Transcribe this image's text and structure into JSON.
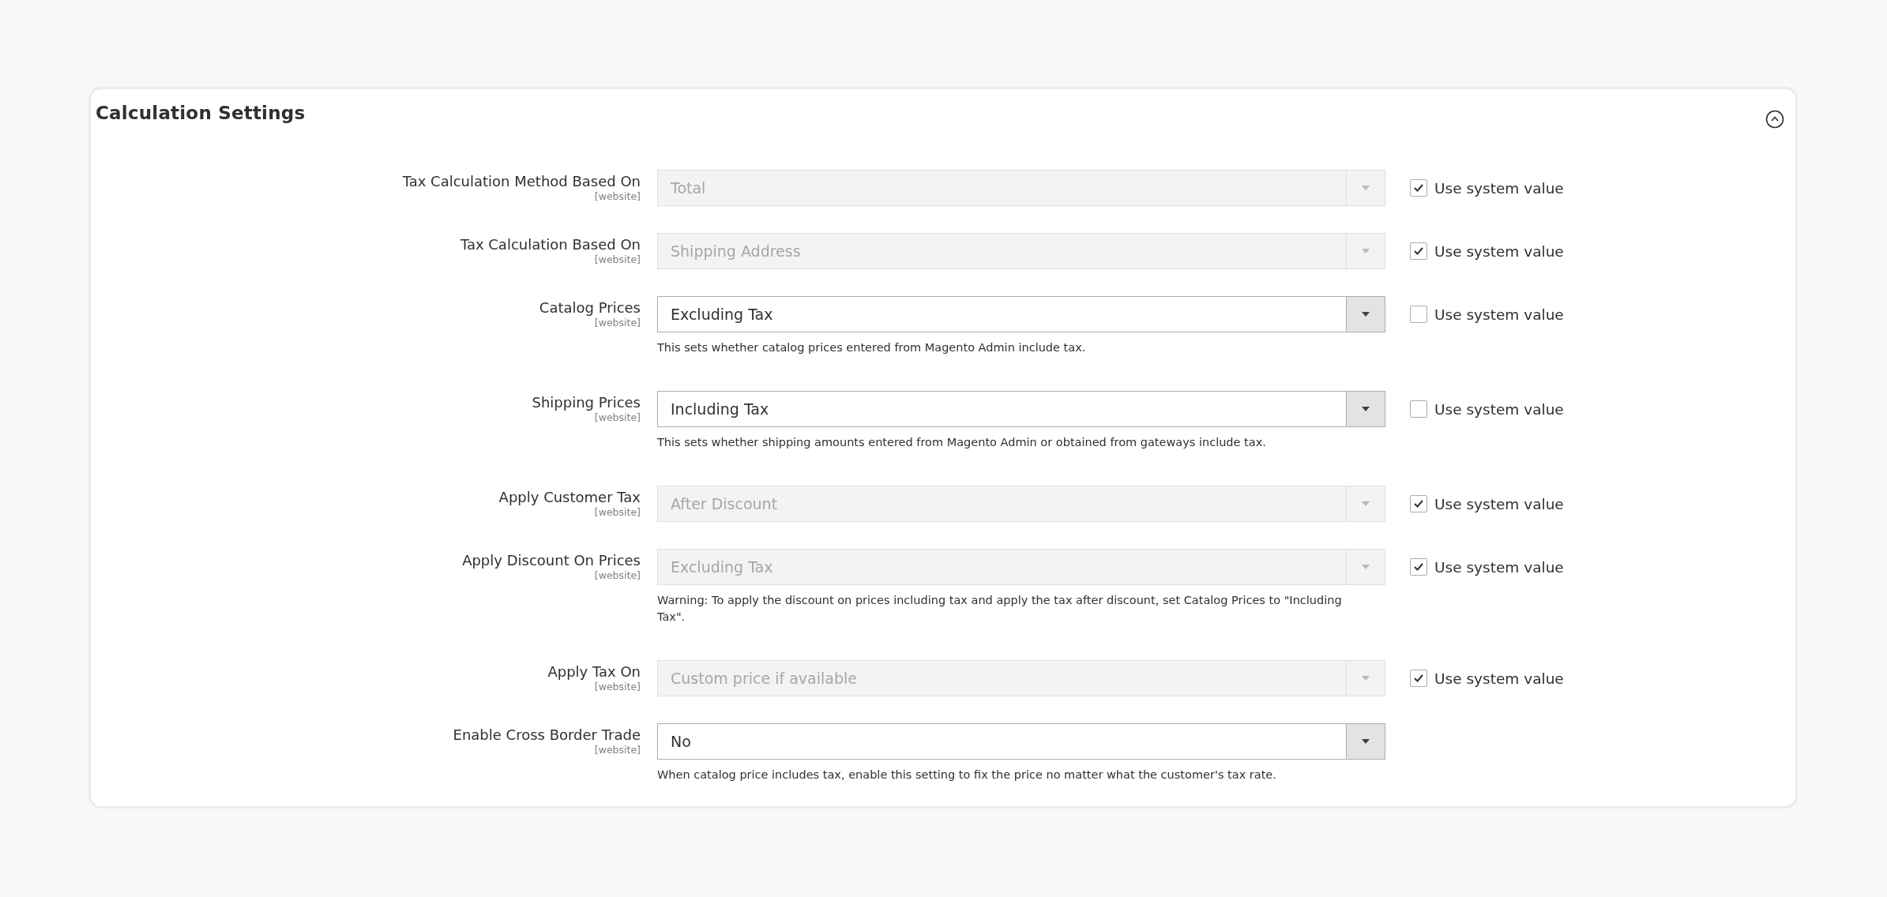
{
  "section": {
    "title": "Calculation Settings",
    "expanded": true
  },
  "fields": [
    {
      "label": "Tax Calculation Method Based On",
      "scope": "[website]",
      "value": "Total",
      "disabled": true,
      "use_system": {
        "checked": true,
        "label": "Use system value"
      }
    },
    {
      "label": "Tax Calculation Based On",
      "scope": "[website]",
      "value": "Shipping Address",
      "disabled": true,
      "use_system": {
        "checked": true,
        "label": "Use system value"
      }
    },
    {
      "label": "Catalog Prices",
      "scope": "[website]",
      "value": "Excluding Tax",
      "disabled": false,
      "use_system": {
        "checked": false,
        "label": "Use system value"
      },
      "note": "This sets whether catalog prices entered from Magento Admin include tax."
    },
    {
      "label": "Shipping Prices",
      "scope": "[website]",
      "value": "Including Tax",
      "disabled": false,
      "use_system": {
        "checked": false,
        "label": "Use system value"
      },
      "note": "This sets whether shipping amounts entered from Magento Admin or obtained from gateways include tax."
    },
    {
      "label": "Apply Customer Tax",
      "scope": "[website]",
      "value": "After Discount",
      "disabled": true,
      "use_system": {
        "checked": true,
        "label": "Use system value"
      }
    },
    {
      "label": "Apply Discount On Prices",
      "scope": "[website]",
      "value": "Excluding Tax",
      "disabled": true,
      "use_system": {
        "checked": true,
        "label": "Use system value"
      },
      "note": "Warning: To apply the discount on prices including tax and apply the tax after discount, set Catalog Prices to \"Including Tax\"."
    },
    {
      "label": "Apply Tax On",
      "scope": "[website]",
      "value": "Custom price if available",
      "disabled": true,
      "use_system": {
        "checked": true,
        "label": "Use system value"
      }
    },
    {
      "label": "Enable Cross Border Trade",
      "scope": "[website]",
      "value": "No",
      "disabled": false,
      "note": "When catalog price includes tax, enable this setting to fix the price no matter what the customer's tax rate."
    }
  ]
}
